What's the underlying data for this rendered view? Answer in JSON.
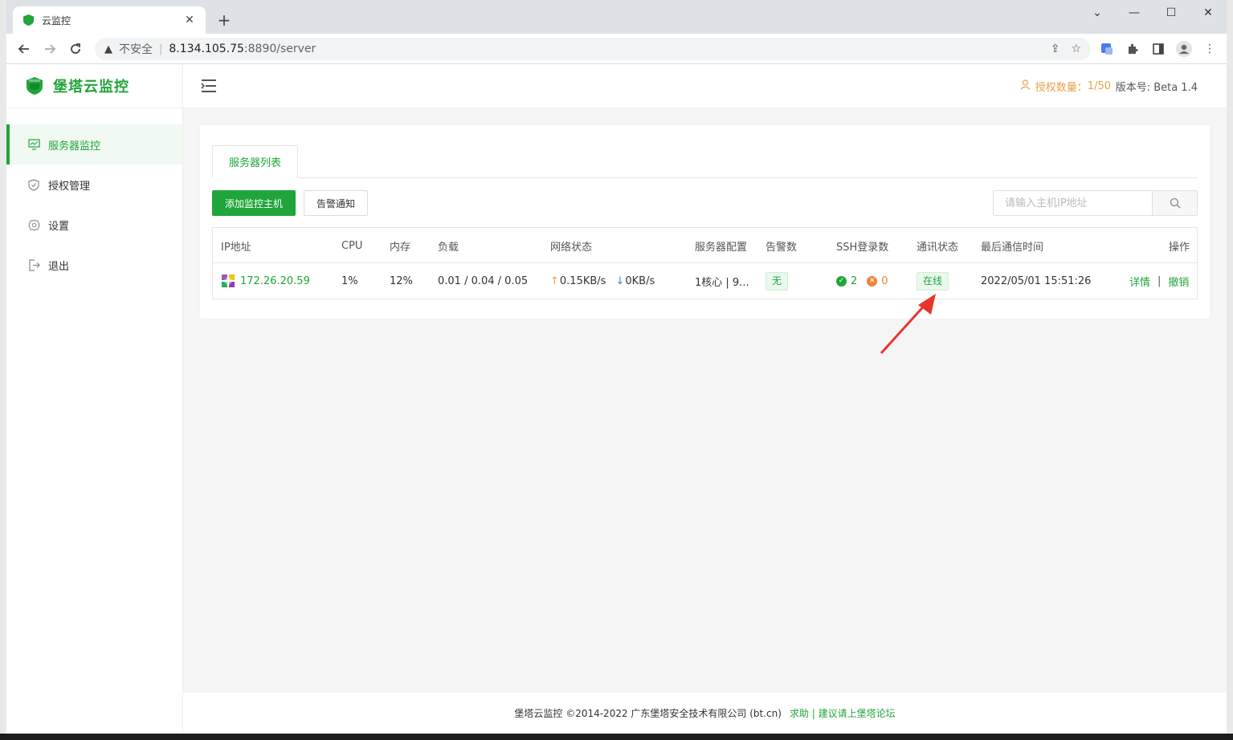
{
  "browser": {
    "tab_title": "云监控",
    "new_tab": "+",
    "insecure_label": "不安全",
    "url_host": "8.134.105.75",
    "url_rest": ":8890/server"
  },
  "app": {
    "brand": "堡塔云监控",
    "license_label": "授权数量：",
    "license_value": "1/50",
    "version": "版本号: Beta 1.4"
  },
  "sidebar": {
    "items": [
      {
        "label": "服务器监控",
        "icon": "monitor-icon"
      },
      {
        "label": "授权管理",
        "icon": "shield-icon"
      },
      {
        "label": "设置",
        "icon": "gear-icon"
      },
      {
        "label": "退出",
        "icon": "logout-icon"
      }
    ]
  },
  "main": {
    "tab_label": "服务器列表",
    "add_button": "添加监控主机",
    "alert_button": "告警通知",
    "search_placeholder": "请输入主机IP地址"
  },
  "table": {
    "headers": [
      "IP地址",
      "CPU",
      "内存",
      "负载",
      "网络状态",
      "服务器配置",
      "告警数",
      "SSH登录数",
      "通讯状态",
      "最后通信时间",
      "操作"
    ],
    "rows": [
      {
        "ip": "172.26.20.59",
        "cpu": "1%",
        "memory": "12%",
        "load": "0.01 / 0.04 / 0.05",
        "net_up": "0.15KB/s",
        "net_down": "0KB/s",
        "config": "1核心 | 9...",
        "alerts": "无",
        "ssh_success": "2",
        "ssh_fail": "0",
        "status": "在线",
        "last_time": "2022/05/01 15:51:26",
        "action_detail": "详情",
        "action_sep": "|",
        "action_revoke": "撤销"
      }
    ]
  },
  "footer": {
    "copyright": "堡塔云监控 ©2014-2022 广东堡塔安全技术有限公司 (bt.cn)",
    "link": "求助 | 建议请上堡塔论坛"
  },
  "colors": {
    "accent": "#20a53a",
    "license": "#e8a04a",
    "arrow": "#e8362e"
  }
}
